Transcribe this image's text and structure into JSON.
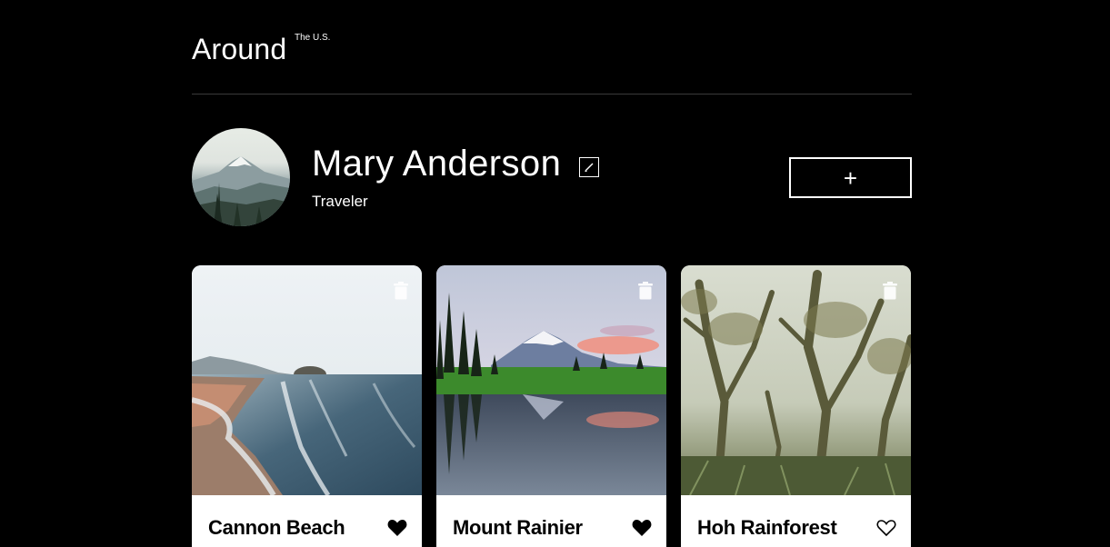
{
  "header": {
    "logo": "Around",
    "logo_superscript": "The U.S."
  },
  "profile": {
    "name": "Mary Anderson",
    "role": "Traveler",
    "edit_icon": "pencil-icon",
    "add_button_label": "+"
  },
  "cards": [
    {
      "title": "Cannon Beach",
      "liked": true,
      "trash_icon": "trash-icon"
    },
    {
      "title": "Mount Rainier",
      "liked": true,
      "trash_icon": "trash-icon"
    },
    {
      "title": "Hoh Rainforest",
      "liked": false,
      "trash_icon": "trash-icon"
    }
  ],
  "colors": {
    "background": "#000000",
    "card_footer": "#ffffff",
    "text_light": "#ffffff",
    "text_dark": "#000000"
  }
}
